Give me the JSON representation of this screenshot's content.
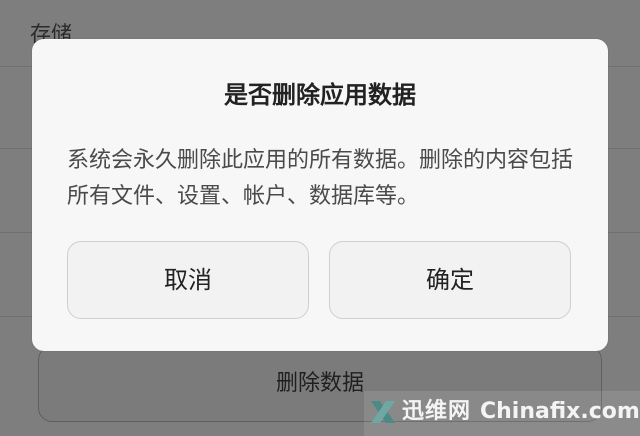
{
  "background": {
    "section_header": "存储",
    "delete_button_label": "删除数据"
  },
  "dialog": {
    "title": "是否删除应用数据",
    "message": "系统会永久删除此应用的所有数据。删除的内容包括所有文件、设置、帐户、数据库等。",
    "cancel_label": "取消",
    "confirm_label": "确定"
  },
  "watermark": {
    "site_name_cn": "迅维网",
    "site_name_en": "Chinafix.com",
    "logo_icon": "x-logo-icon"
  }
}
